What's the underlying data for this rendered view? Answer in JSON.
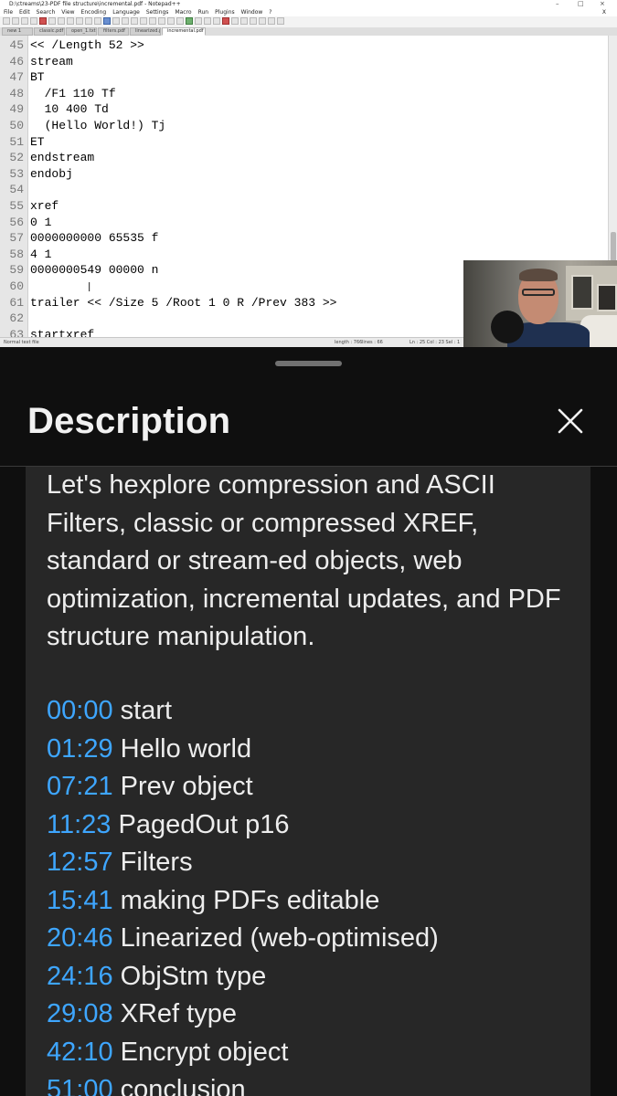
{
  "window": {
    "title": "D:\\ctreams\\23-PDF file structure\\incremental.pdf - Notepad++"
  },
  "menu": [
    "File",
    "Edit",
    "Search",
    "View",
    "Encoding",
    "Language",
    "Settings",
    "Macro",
    "Run",
    "Plugins",
    "Window",
    "?"
  ],
  "tabs": [
    "new 1",
    "classic.pdf",
    "open_1.txt",
    "filters.pdf",
    "linearized.pdf",
    "incremental.pdf"
  ],
  "editor": {
    "lines": [
      {
        "n": "45",
        "text": "<< /Length 52 >>"
      },
      {
        "n": "46",
        "text": "stream"
      },
      {
        "n": "47",
        "text": "BT"
      },
      {
        "n": "48",
        "text": "  /F1 110 Tf"
      },
      {
        "n": "49",
        "text": "  10 400 Td"
      },
      {
        "n": "50",
        "text": "  (Hello World!) Tj"
      },
      {
        "n": "51",
        "text": "ET"
      },
      {
        "n": "52",
        "text": "endstream"
      },
      {
        "n": "53",
        "text": "endobj"
      },
      {
        "n": "54",
        "text": ""
      },
      {
        "n": "55",
        "text": "xref"
      },
      {
        "n": "56",
        "text": "0 1"
      },
      {
        "n": "57",
        "text": "0000000000 65535 f"
      },
      {
        "n": "58",
        "text": "4 1"
      },
      {
        "n": "59",
        "text": "0000000549 00000 n"
      },
      {
        "n": "60",
        "text": ""
      },
      {
        "n": "61",
        "text": "trailer << /Size 5 /Root 1 0 R /Prev 383 >>"
      },
      {
        "n": "62",
        "text": ""
      },
      {
        "n": "63",
        "text": "startxref"
      }
    ]
  },
  "status": {
    "file_type": "Normal text file",
    "length": "length : 766",
    "lines": "lines : 66",
    "position": "Ln : 25   Col : 23   Sel : 1"
  },
  "sheet": {
    "title": "Description",
    "description": "Let's hexplore compression and ASCII Filters, classic or compressed XREF, standard or stream-ed objects, web optimization, incremental updates, and PDF structure manipulation.",
    "chapters": [
      {
        "time": "00:00",
        "label": "start"
      },
      {
        "time": "01:29",
        "label": "Hello world"
      },
      {
        "time": "07:21",
        "label": "Prev object"
      },
      {
        "time": "11:23",
        "label": "PagedOut p16"
      },
      {
        "time": "12:57",
        "label": "Filters"
      },
      {
        "time": "15:41",
        "label": "making PDFs editable"
      },
      {
        "time": "20:46",
        "label": "Linearized (web-optimised)"
      },
      {
        "time": "24:16",
        "label": "ObjStm type"
      },
      {
        "time": "29:08",
        "label": "XRef type"
      },
      {
        "time": "42:10",
        "label": "Encrypt object"
      },
      {
        "time": "51:00",
        "label": "conclusion"
      }
    ]
  },
  "colors": {
    "sheet_bg": "#0f0f0f",
    "card_bg": "#272727",
    "timestamp": "#3ea6ff",
    "text": "#ededed"
  },
  "icons": [
    "close-icon"
  ]
}
